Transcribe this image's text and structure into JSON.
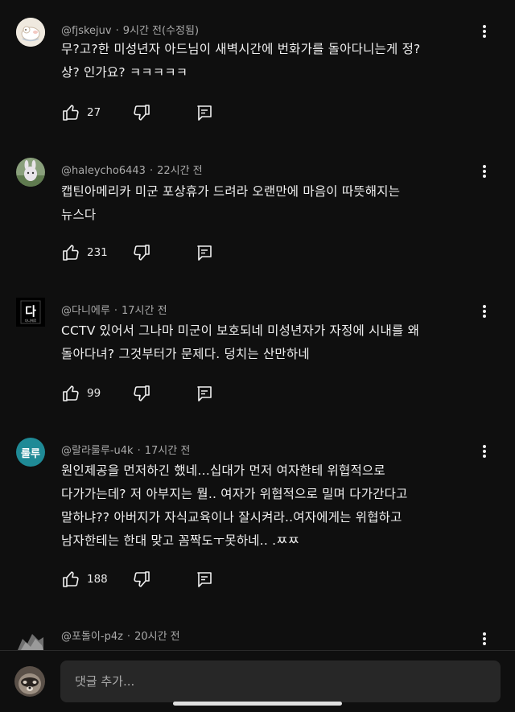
{
  "comments": [
    {
      "handle": "@fjskejuv",
      "time": "9시간 전(수정됨)",
      "lines": [
        "무?고?한 미성년자 아드님이 새벽시간에 번화가를 돌아다니는게 정?",
        "상? 인가요? ㅋㅋㅋㅋㅋ"
      ],
      "likes": "27"
    },
    {
      "handle": "@haleycho6443",
      "time": "22시간 전",
      "lines": [
        "캡틴아메리카 미군 포상휴가 드려라 오랜만에 마음이 따뜻해지는",
        "뉴스다"
      ],
      "likes": "231"
    },
    {
      "handle": "@다니에루",
      "time": "17시간 전",
      "lines": [
        "CCTV 있어서 그나마 미군이 보호되네   미성년자가 자정에 시내를 왜",
        "돌아다녀? 그것부터가 문제다.  덩치는 산만하네"
      ],
      "likes": "99",
      "avatar_text": "다",
      "avatar_subtext": "다니에루"
    },
    {
      "handle": "@랄라룰루-u4k",
      "time": "17시간 전",
      "lines": [
        "원인제공을 먼저하긴 했네…십대가 먼저 여자한테 위협적으로",
        "다가가는데? 저 아부지는 뭘.. 여자가 위협적으로 밀며 다가간다고",
        "말하냐?? 아버지가 자식교육이나 잘시켜라..여자에게는 위협하고",
        "남자한테는 한대 맞고 꼼짝도ㅜ못하네.. .ㅉㅉ"
      ],
      "likes": "188",
      "avatar_text": "룰루"
    },
    {
      "handle": "@포돌이-p4z",
      "time": "20시간 전"
    }
  ],
  "composer": {
    "placeholder": "댓글 추가..."
  },
  "colors": {
    "background": "#0f0f0f",
    "text": "#f1f1f1",
    "meta": "#aaaaaa",
    "input_bg": "#272727",
    "teal_avatar": "#1f8a96"
  }
}
